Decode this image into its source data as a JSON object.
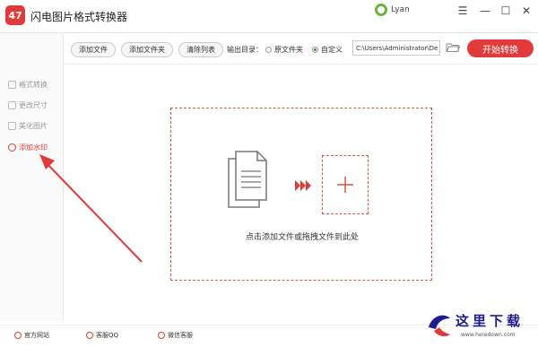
{
  "app": {
    "logo_text": "47",
    "title": "闪电图片格式转换器"
  },
  "user": {
    "name": "Lyan"
  },
  "window_controls": {
    "menu": "☰",
    "minimize": "—",
    "maximize": "☐",
    "close": "✕"
  },
  "sidebar": {
    "items": [
      {
        "label": "格式转换",
        "active": false
      },
      {
        "label": "更改尺寸",
        "active": false
      },
      {
        "label": "美化图片",
        "active": false
      },
      {
        "label": "添加水印",
        "active": true
      }
    ]
  },
  "toolbar": {
    "add_file": "添加文件",
    "add_folder": "添加文件夹",
    "clear_list": "清除列表",
    "output_dir_label": "输出目录：",
    "radio_original": "原文件夹",
    "radio_custom": "自定义",
    "selected_output": "自定义",
    "path": "C:\\Users\\Administrator\\De",
    "start": "开始转换"
  },
  "dropzone": {
    "hint": "点击添加文件或拖拽文件到此处"
  },
  "footer": {
    "links": [
      "官方网站",
      "客服QQ",
      "微信客服"
    ]
  },
  "watermark": {
    "text": "这里下载",
    "url": "www.heredown.com"
  },
  "colors": {
    "accent": "#e03a3a",
    "arrow": "#e03a3a"
  }
}
